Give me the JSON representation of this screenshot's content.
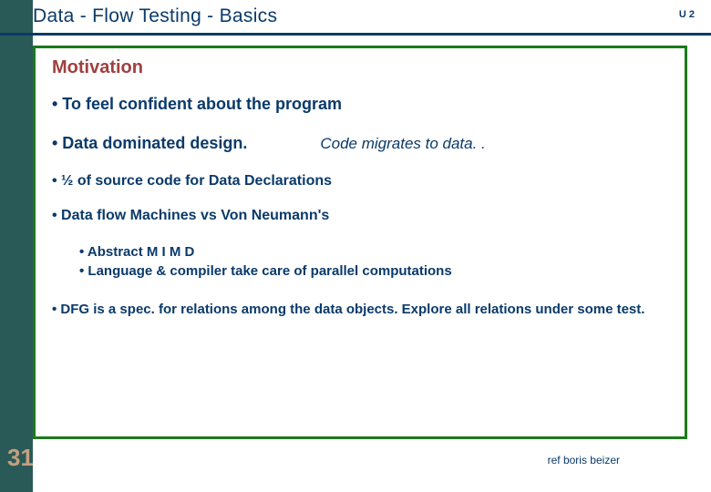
{
  "header": {
    "title": "Data - Flow Testing  -  Basics",
    "corner": "U 2"
  },
  "content": {
    "subhead": "Motivation",
    "bullets": {
      "b1": "• To feel confident about the program",
      "b2_label": "• Data dominated design.",
      "b2_aside": "Code migrates to data. .",
      "b3": "• ½ of source code for Data Declarations",
      "b4": "• Data flow Machines   vs   Von Neumann's",
      "sub": {
        "s1": "•   Abstract M I M D",
        "s2": "•   Language & compiler take care of parallel computations"
      },
      "b5": "• DFG is a spec. for relations among the data objects.  Explore all relations under some test."
    }
  },
  "footer": {
    "page": "31",
    "ref": "ref boris beizer"
  }
}
